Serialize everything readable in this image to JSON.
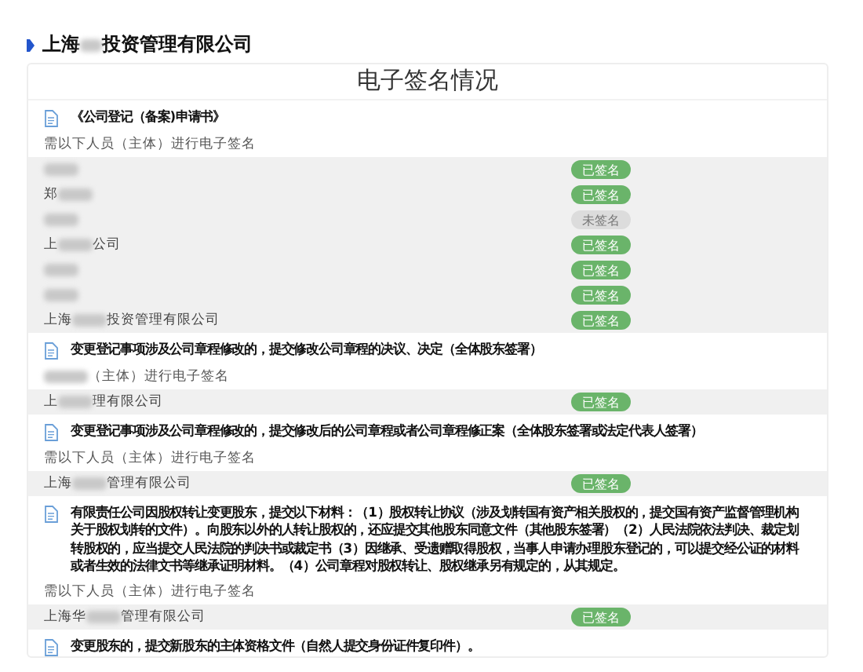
{
  "company_heading": [
    {
      "kind": "text",
      "text": "上海"
    },
    {
      "kind": "blur"
    },
    {
      "kind": "text",
      "text": "投资管理有限公司"
    }
  ],
  "card_title": "电子签名情况",
  "sections": [
    {
      "title": "《公司登记（备案)申请书》",
      "subtitle": [
        {
          "kind": "text",
          "text": "需以下人员（主体）进行电子签名"
        }
      ],
      "signers": [
        {
          "name": [
            {
              "kind": "blur"
            }
          ],
          "status": "已签名",
          "signed": true
        },
        {
          "name": [
            {
              "kind": "text",
              "text": "郑"
            },
            {
              "kind": "blur"
            }
          ],
          "status": "已签名",
          "signed": true
        },
        {
          "name": [
            {
              "kind": "blur"
            }
          ],
          "status": "未签名",
          "signed": false
        },
        {
          "name": [
            {
              "kind": "text",
              "text": "上"
            },
            {
              "kind": "blur"
            },
            {
              "kind": "text",
              "text": "公司"
            }
          ],
          "status": "已签名",
          "signed": true
        },
        {
          "name": [
            {
              "kind": "blur"
            }
          ],
          "status": "已签名",
          "signed": true
        },
        {
          "name": [
            {
              "kind": "blur"
            }
          ],
          "status": "已签名",
          "signed": true
        },
        {
          "name": [
            {
              "kind": "text",
              "text": "上海"
            },
            {
              "kind": "blur"
            },
            {
              "kind": "text",
              "text": "投资管理有限公司"
            }
          ],
          "status": "已签名",
          "signed": true
        }
      ]
    },
    {
      "title": "变更登记事项涉及公司章程修改的，提交修改公司章程的决议、决定（全体股东签署）",
      "subtitle": [
        {
          "kind": "blur"
        },
        {
          "kind": "text",
          "text": "（主体）进行电子签名"
        }
      ],
      "signers": [
        {
          "name": [
            {
              "kind": "text",
              "text": "上"
            },
            {
              "kind": "blur"
            },
            {
              "kind": "text",
              "text": "理有限公司"
            }
          ],
          "status": "已签名",
          "signed": true
        }
      ]
    },
    {
      "title": "变更登记事项涉及公司章程修改的，提交修改后的公司章程或者公司章程修正案（全体股东签署或法定代表人签署）",
      "subtitle": [
        {
          "kind": "text",
          "text": "需以下人员（主体）进行电子签名"
        }
      ],
      "signers": [
        {
          "name": [
            {
              "kind": "text",
              "text": "上海"
            },
            {
              "kind": "blur"
            },
            {
              "kind": "text",
              "text": "管理有限公司"
            }
          ],
          "status": "已签名",
          "signed": true
        }
      ]
    },
    {
      "title": "有限责任公司因股权转让变更股东，提交以下材料：（1）股权转让协议（涉及划转国有资产相关股权的，提交国有资产监督管理机构关于股权划转的文件）。向股东以外的人转让股权的，还应提交其他股东同意文件（其他股东签署）（2）人民法院依法判决、裁定划转股权的，应当提交人民法院的判决书或裁定书（3）因继承、受遗赠取得股权，当事人申请办理股东登记的，可以提交经公证的材料或者生效的法律文书等继承证明材料。（4）公司章程对股权转让、股权继承另有规定的，从其规定。",
      "subtitle": [
        {
          "kind": "text",
          "text": "需以下人员（主体）进行电子签名"
        }
      ],
      "signers": [
        {
          "name": [
            {
              "kind": "text",
              "text": "上海华"
            },
            {
              "kind": "blur"
            },
            {
              "kind": "text",
              "text": "管理有限公司"
            }
          ],
          "status": "已签名",
          "signed": true
        }
      ]
    },
    {
      "title": "变更股东的，提交新股东的主体资格文件（自然人提交身份证件复印件）。"
    }
  ]
}
